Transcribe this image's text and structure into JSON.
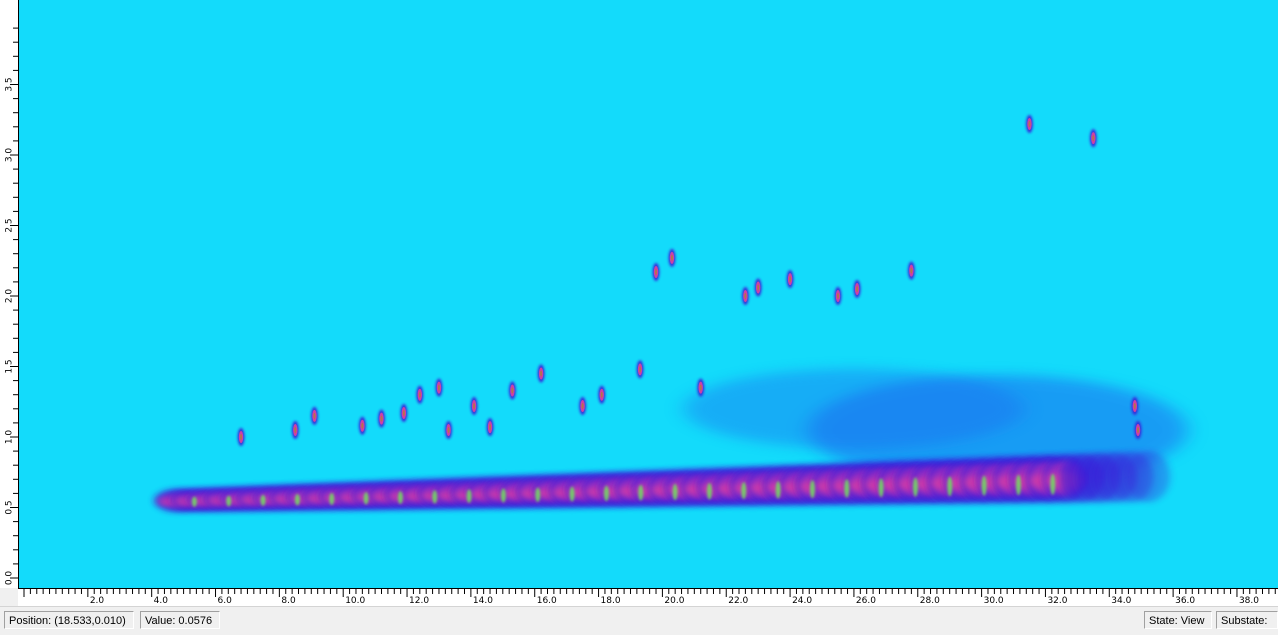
{
  "chart_data": {
    "type": "heatmap",
    "title": "",
    "xlabel": "",
    "ylabel": "",
    "xlim": [
      0.0,
      39.5
    ],
    "ylim": [
      0.0,
      3.9
    ],
    "x_ticks": [
      "2.0",
      "4.0",
      "6.0",
      "8.0",
      "10.0",
      "12.0",
      "14.0",
      "16.0",
      "18.0",
      "20.0",
      "22.0",
      "24.0",
      "26.0",
      "28.0",
      "30.0",
      "32.0",
      "34.0",
      "36.0",
      "38.0"
    ],
    "y_ticks": [
      "0.0",
      "0.5",
      "1.0",
      "1.5",
      "2.0",
      "2.5",
      "3.0",
      "3.5"
    ],
    "x_tick_values": [
      2,
      4,
      6,
      8,
      10,
      12,
      14,
      16,
      18,
      20,
      22,
      24,
      26,
      28,
      30,
      32,
      34,
      36,
      38
    ],
    "y_tick_values": [
      0,
      0.5,
      1.0,
      1.5,
      2.0,
      2.5,
      3.0,
      3.5
    ],
    "background_color": "#13dbfb",
    "colormap": [
      "#13dbfb",
      "#1f6af0",
      "#3b1fd8",
      "#a030c0",
      "#e040a0",
      "#b07a40",
      "#6fe060"
    ],
    "main_band": {
      "x_start": 4.8,
      "x_end": 35.2,
      "y_center_start": 0.55,
      "y_center_end": 0.72,
      "y_halfwidth_start": 0.04,
      "y_halfwidth_end": 0.14
    },
    "peaks": [
      {
        "x": 6.8,
        "y": 1.0
      },
      {
        "x": 8.5,
        "y": 1.05
      },
      {
        "x": 9.1,
        "y": 1.15
      },
      {
        "x": 10.6,
        "y": 1.08
      },
      {
        "x": 11.2,
        "y": 1.13
      },
      {
        "x": 11.9,
        "y": 1.17
      },
      {
        "x": 12.4,
        "y": 1.3
      },
      {
        "x": 13.0,
        "y": 1.35
      },
      {
        "x": 13.3,
        "y": 1.05
      },
      {
        "x": 14.1,
        "y": 1.22
      },
      {
        "x": 14.6,
        "y": 1.07
      },
      {
        "x": 15.3,
        "y": 1.33
      },
      {
        "x": 16.2,
        "y": 1.45
      },
      {
        "x": 17.5,
        "y": 1.22
      },
      {
        "x": 18.1,
        "y": 1.3
      },
      {
        "x": 19.3,
        "y": 1.48
      },
      {
        "x": 19.8,
        "y": 2.17
      },
      {
        "x": 20.3,
        "y": 2.27
      },
      {
        "x": 21.2,
        "y": 1.35
      },
      {
        "x": 22.6,
        "y": 2.0
      },
      {
        "x": 23.0,
        "y": 2.06
      },
      {
        "x": 24.0,
        "y": 2.12
      },
      {
        "x": 25.5,
        "y": 2.0
      },
      {
        "x": 26.1,
        "y": 2.05
      },
      {
        "x": 34.8,
        "y": 1.22
      },
      {
        "x": 34.9,
        "y": 1.05
      },
      {
        "x": 31.5,
        "y": 3.22
      },
      {
        "x": 33.5,
        "y": 3.12
      },
      {
        "x": 27.8,
        "y": 2.18
      }
    ]
  },
  "status_bar": {
    "position": "Position: (18.533,0.010)",
    "value": "Value: 0.0576",
    "state": "State: View",
    "substate": "Substate:"
  }
}
